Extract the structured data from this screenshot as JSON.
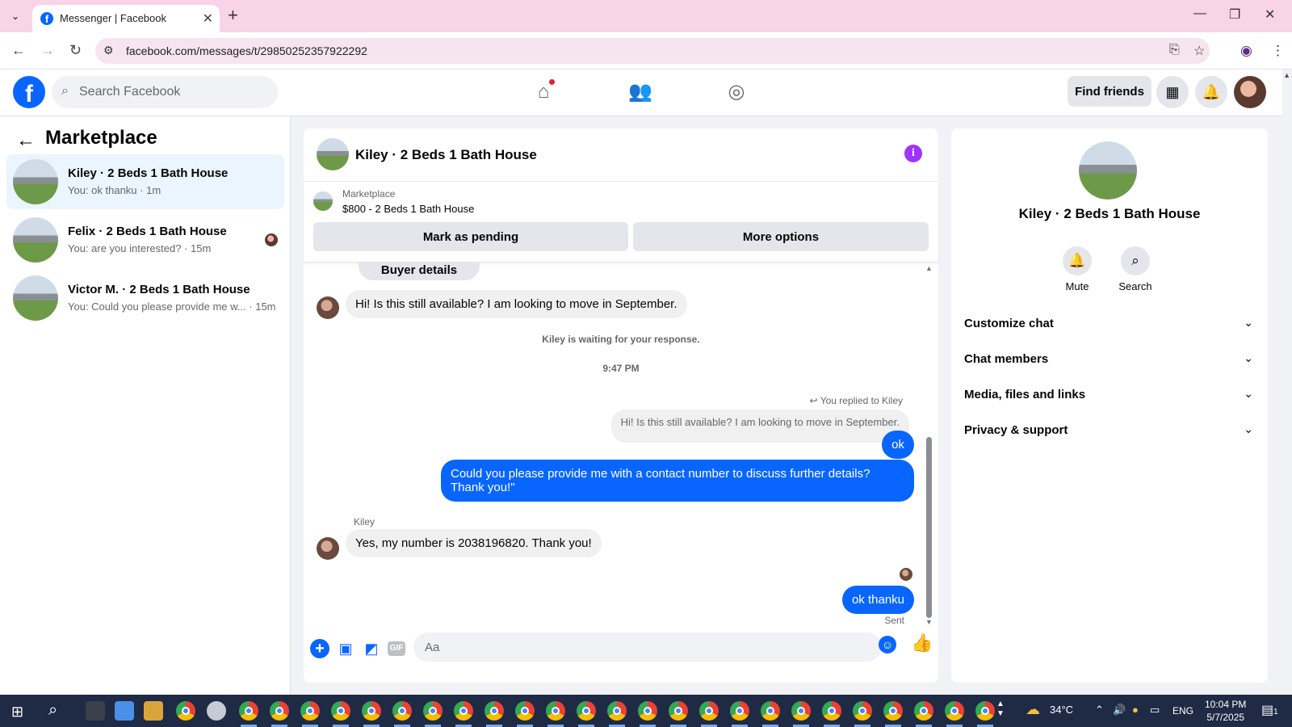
{
  "browser": {
    "tab_title": "Messenger | Facebook",
    "url": "facebook.com/messages/t/29850252357922292"
  },
  "header": {
    "search_placeholder": "Search Facebook",
    "find_friends_label": "Find friends"
  },
  "sidebar": {
    "title": "Marketplace",
    "conversations": [
      {
        "name": "Kiley · 2 Beds 1 Bath House",
        "preview": "You: ok thanku · 1m",
        "active": true
      },
      {
        "name": "Felix · 2 Beds 1 Bath House",
        "preview": "You: are you interested? · 15m",
        "active": false
      },
      {
        "name": "Victor M. · 2 Beds 1 Bath House",
        "preview": "You: Could you please provide me w... · 15m",
        "active": false
      }
    ]
  },
  "chat": {
    "title": "Kiley · 2 Beds 1 Bath House",
    "marketplace_label": "Marketplace",
    "listing": "$800 - 2 Beds 1 Bath House",
    "mark_pending_label": "Mark as pending",
    "more_options_label": "More options",
    "buyer_details_label": "Buyer details",
    "messages": {
      "incoming_1": "Hi! Is this still available? I am looking to move in September.",
      "waiting_text": "Kiley is waiting for your response.",
      "timestamp": "9:47 PM",
      "reply_meta": "You replied to Kiley",
      "quoted": "Hi! Is this still available? I am looking to move in September.",
      "outgoing_1": "ok",
      "outgoing_2": "Could you please provide me with a contact number to discuss further details? Thank you!\"",
      "sender_label": "Kiley",
      "incoming_2": "Yes, my number is 2038196820. Thank you!",
      "outgoing_3": "ok thanku",
      "status": "Sent"
    },
    "composer_placeholder": "Aa"
  },
  "right_panel": {
    "name": "Kiley · 2 Beds 1 Bath House",
    "mute_label": "Mute",
    "search_label": "Search",
    "sections": [
      "Customize chat",
      "Chat members",
      "Media, files and links",
      "Privacy & support"
    ]
  },
  "taskbar": {
    "temperature": "34°C",
    "language": "ENG",
    "time": "10:04 PM",
    "date": "5/7/2025",
    "notification_count": "1"
  },
  "colors": {
    "accent": "#0866ff",
    "info": "#a033ff",
    "tab_bar": "#f9d3e8"
  }
}
